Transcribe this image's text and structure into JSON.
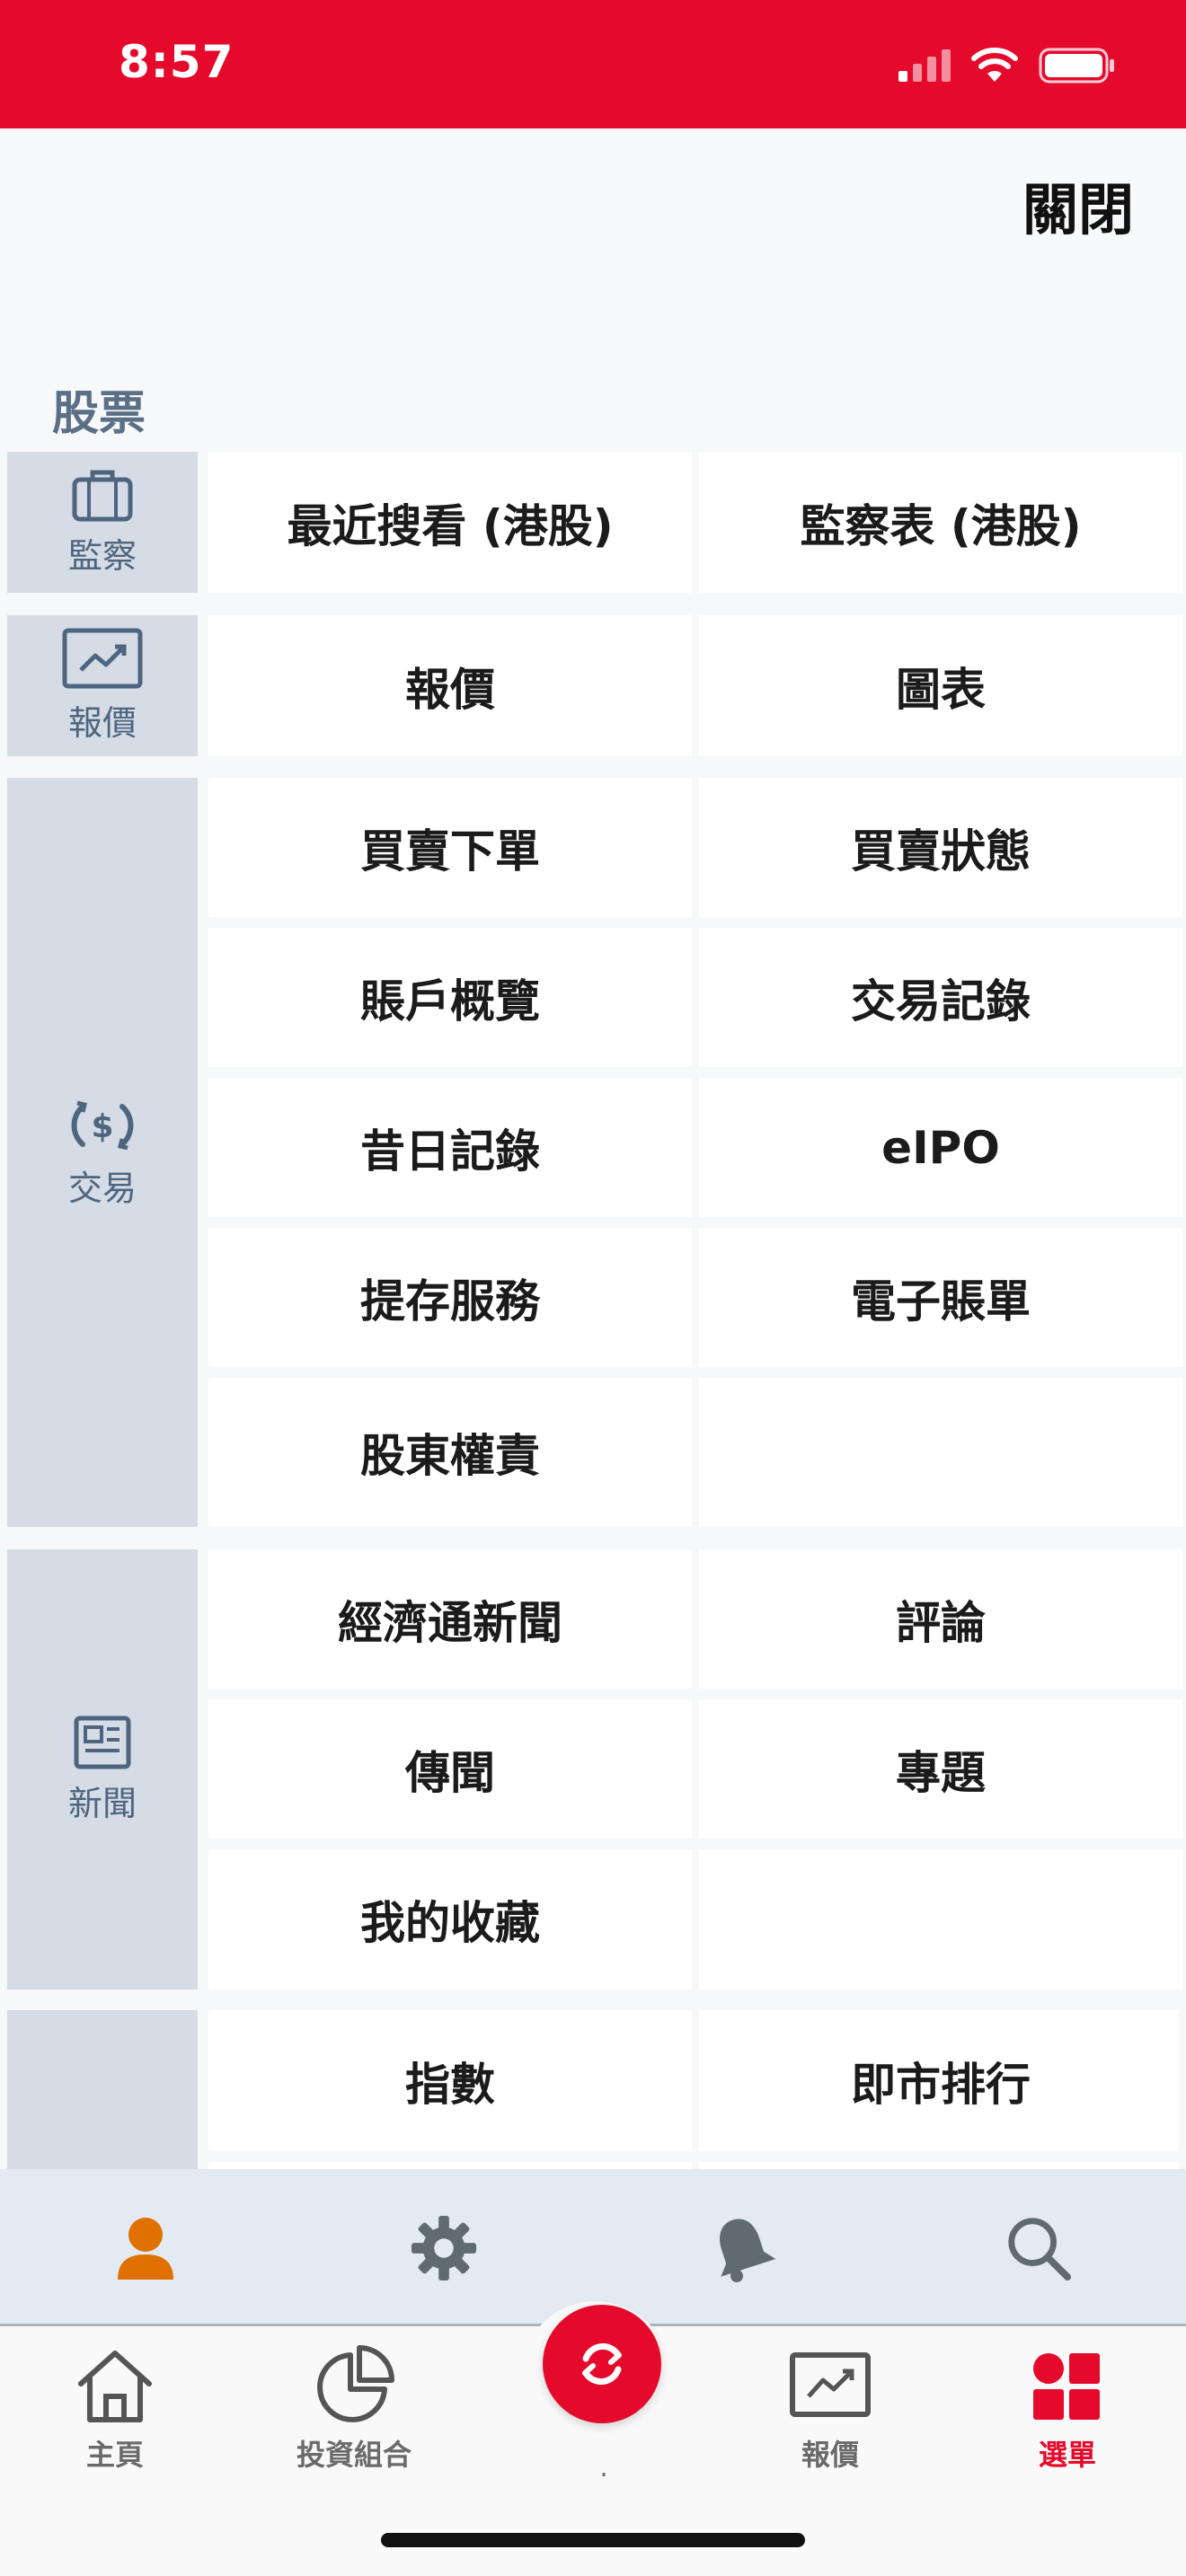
{
  "status_bar": {
    "time": "8:57"
  },
  "header": {
    "close_label": "關閉"
  },
  "section": {
    "title": "股票"
  },
  "groups": {
    "watch": {
      "label": "監察",
      "rows": [
        [
          "最近搜看 (港股)",
          "監察表 (港股)"
        ]
      ]
    },
    "quote": {
      "label": "報價",
      "rows": [
        [
          "報價",
          "圖表"
        ]
      ]
    },
    "trade": {
      "label": "交易",
      "rows": [
        [
          "買賣下單",
          "買賣狀態"
        ],
        [
          "賬戶概覽",
          "交易記錄"
        ],
        [
          "昔日記錄",
          "eIPO"
        ],
        [
          "提存服務",
          "電子賬單"
        ],
        [
          "股東權責",
          ""
        ]
      ]
    },
    "news": {
      "label": "新聞",
      "rows": [
        [
          "經濟通新聞",
          "評論"
        ],
        [
          "傳聞",
          "專題"
        ],
        [
          "我的收藏",
          ""
        ]
      ]
    },
    "market": {
      "label": "",
      "rows": [
        [
          "指數",
          "即市排行"
        ]
      ]
    }
  },
  "tab_strip": {
    "icons": [
      "person-icon",
      "gear-icon",
      "bell-icon",
      "search-icon"
    ],
    "active_color": "#e07000"
  },
  "bottom_nav": {
    "items": [
      {
        "label": "主頁",
        "icon": "home-icon"
      },
      {
        "label": "投資組合",
        "icon": "pie-chart-icon"
      },
      {
        "label": "報價",
        "icon": "chart-icon"
      },
      {
        "label": "選單",
        "icon": "menu-grid-icon"
      }
    ],
    "fab_label": ".",
    "active_color": "#e5092b"
  }
}
